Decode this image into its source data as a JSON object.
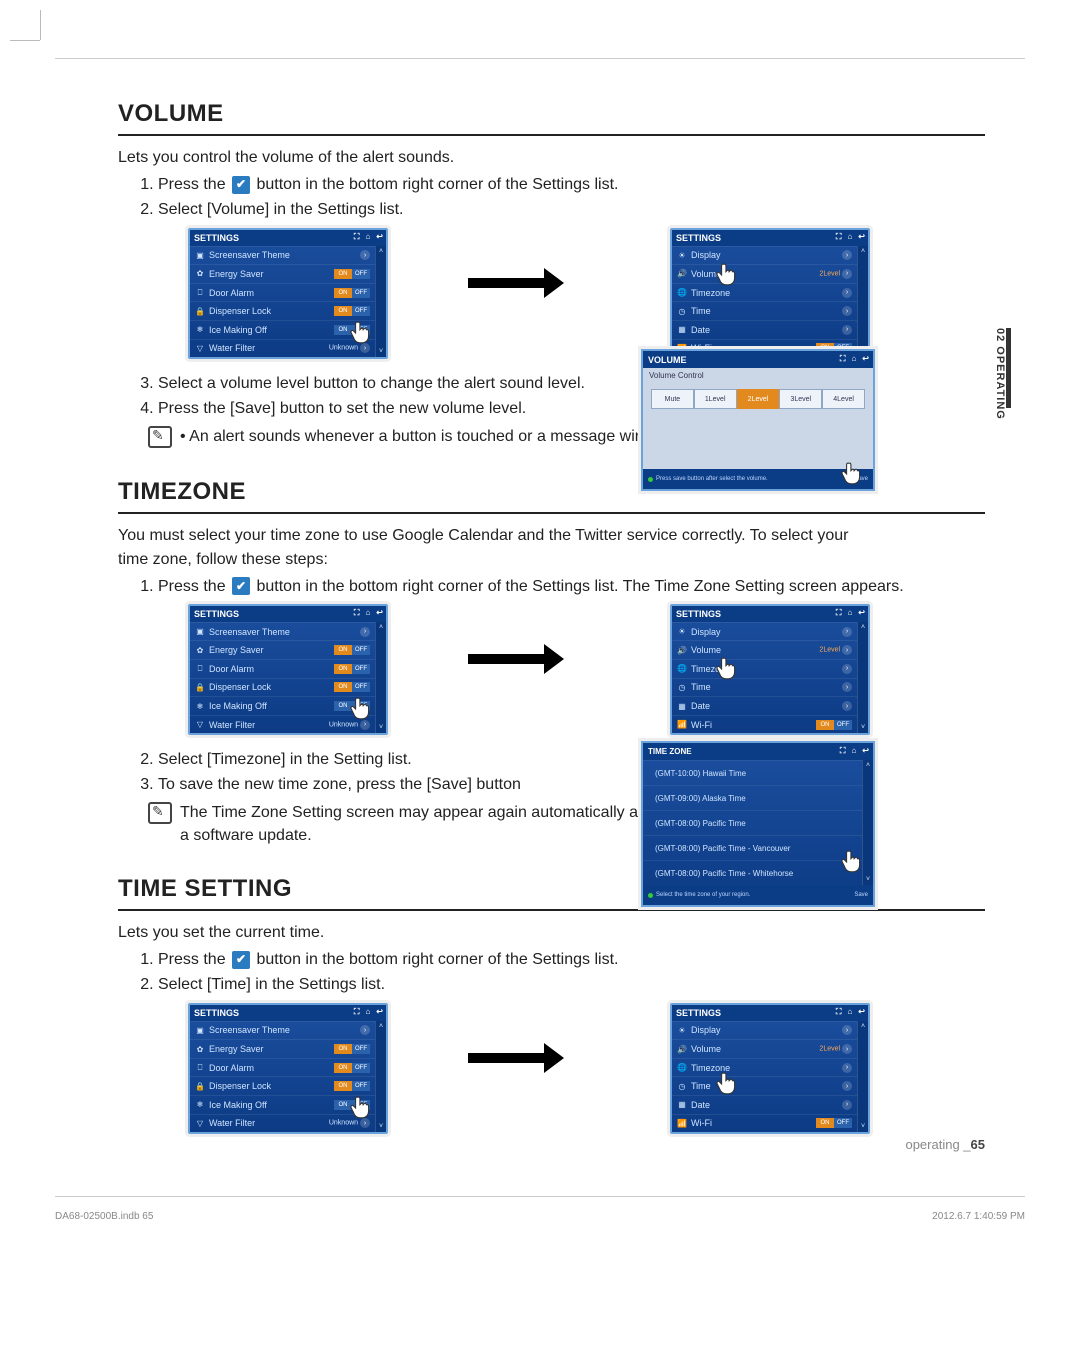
{
  "side_tab": "02 OPERATING",
  "page_footer_right": "operating _65",
  "print_footer_left": "DA68-02500B.indb   65",
  "print_footer_right": "2012.6.7   1:40:59 PM",
  "settings_panel_left": {
    "title": "SETTINGS",
    "rows": [
      {
        "icon": "image-icon",
        "label": "Screensaver Theme",
        "right": "chev"
      },
      {
        "icon": "leaf-icon",
        "label": "Energy Saver",
        "right": "toggle_off"
      },
      {
        "icon": "door-icon",
        "label": "Door Alarm",
        "right": "toggle_off"
      },
      {
        "icon": "lock-icon",
        "label": "Dispenser Lock",
        "right": "toggle_off"
      },
      {
        "icon": "ice-icon",
        "label": "Ice Making Off",
        "right": "toggle_on_blank"
      },
      {
        "icon": "filter-icon",
        "label": "Water Filter",
        "right": "status_unknown"
      }
    ],
    "status_unknown": "Unknown"
  },
  "settings_panel_right": {
    "title": "SETTINGS",
    "rows": [
      {
        "icon": "sun-icon",
        "label": "Display",
        "right": "chev"
      },
      {
        "icon": "speaker-icon",
        "label": "Volume",
        "right": "status_volume"
      },
      {
        "icon": "globe-icon",
        "label": "Timezone",
        "right": "chev"
      },
      {
        "icon": "clock-icon",
        "label": "Time",
        "right": "chev"
      },
      {
        "icon": "calendar-icon",
        "label": "Date",
        "right": "chev"
      },
      {
        "icon": "wifi-icon",
        "label": "Wi-Fi",
        "right": "toggle_off"
      }
    ],
    "status_volume": "2Level"
  },
  "volume_panel": {
    "title": "VOLUME",
    "sub": "Volume Control",
    "options": [
      "Mute",
      "1Level",
      "2Level",
      "3Level",
      "4Level"
    ],
    "active_index": 2,
    "footer_left": "Press save button after select the volume.",
    "footer_right": "Save"
  },
  "timezone_panel": {
    "title": "TIME ZONE",
    "rows": [
      "(GMT-10:00) Hawaii Time",
      "(GMT-09:00) Alaska Time",
      "(GMT-08:00) Pacific Time",
      "(GMT-08:00) Pacific Time - Vancouver",
      "(GMT-08:00) Pacific Time - Whitehorse"
    ],
    "footer_left": "Select the time zone of your region.",
    "footer_right": "Save"
  },
  "section_volume": {
    "title": "VOLUME",
    "intro": "Lets you control the volume of the alert sounds.",
    "step1_a": "Press the ",
    "step1_b": " button in the bottom right corner of the Settings list.",
    "step2": "Select [Volume] in the Settings list.",
    "step3": "Select a volume level button to change the alert sound level.",
    "step4": "Press the [Save] button to set the new volume level.",
    "note": "An alert sounds whenever a button is touched or a message window or menu list appears."
  },
  "section_timezone": {
    "title": "TIMEZONE",
    "intro": "You must select your time zone to use Google Calendar and the Twitter service correctly. To select your time zone, follow these steps:",
    "step1_a": "Press the ",
    "step1_b": " button in the bottom right corner of the Settings list. The Time Zone Setting screen appears.",
    "step2": "Select [Timezone] in the Setting list.",
    "step3": "To save the new time zone, press the [Save] button",
    "note": "The Time Zone Setting screen may appear again automatically after a software update."
  },
  "section_time": {
    "title": "TIME SETTING",
    "intro": "Lets you set the current time.",
    "step1_a": "Press the ",
    "step1_b": " button in the bottom right corner of the Settings list.",
    "step2": "Select [Time] in the Settings list."
  }
}
